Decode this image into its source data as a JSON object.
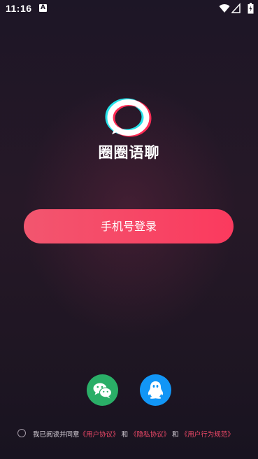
{
  "status_bar": {
    "time": "11:16",
    "notification_icon": "A"
  },
  "app": {
    "name": "圈圈语聊"
  },
  "login": {
    "phone_login_label": "手机号登录"
  },
  "social_login": {
    "wechat_icon": "wechat-icon",
    "qq_icon": "qq-icon"
  },
  "agreement": {
    "prefix": "我已阅读并同意",
    "user_agreement": "《用户协议》",
    "and1": "和",
    "privacy_agreement": "《隐私协议》",
    "and2": "和",
    "behavior_rules": "《用户行为规范》"
  },
  "colors": {
    "accent": "#fb3a5e",
    "wechat": "#2aae67",
    "qq": "#1296f6",
    "background": "#1d1626"
  }
}
